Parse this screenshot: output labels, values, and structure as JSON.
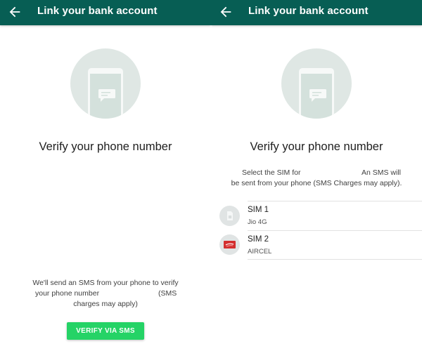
{
  "colors": {
    "app_bar": "#075e54",
    "accent_button": "#25d366",
    "illustration_circle": "#dfe7e4",
    "sim2_badge": "#d32f2f"
  },
  "left_screen": {
    "app_bar": {
      "back_icon": "arrow-back-icon",
      "title": "Link your bank account"
    },
    "heading": "Verify your phone number",
    "info_line1": "We'll send an SMS from your phone to verify",
    "info_line2_start": "your phone number",
    "info_line2_end": "(SMS",
    "info_line3": "charges may apply)",
    "verify_button": "VERIFY VIA SMS"
  },
  "right_screen": {
    "app_bar": {
      "back_icon": "arrow-back-icon",
      "title": "Link your bank account"
    },
    "heading": "Verify your phone number",
    "prompt_line1_start": "Select the SIM for",
    "prompt_line1_end": "An SMS will",
    "prompt_line2": "be sent from your phone (SMS Charges may apply).",
    "sims": [
      {
        "name": "SIM 1",
        "carrier": "Jio 4G",
        "icon": "sim-card-icon"
      },
      {
        "name": "SIM 2",
        "carrier": "AIRCEL",
        "icon": "aircel-sim-icon"
      }
    ]
  }
}
